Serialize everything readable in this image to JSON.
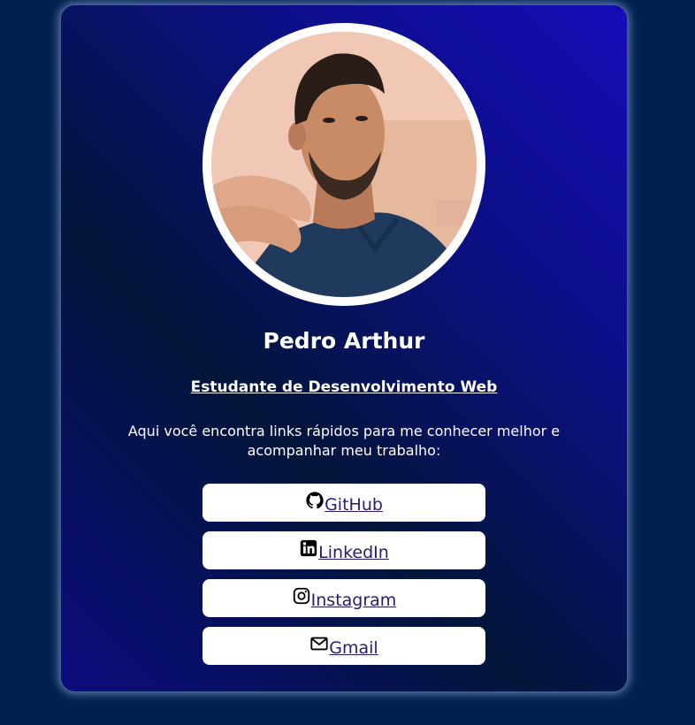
{
  "profile": {
    "name": "Pedro Arthur",
    "role": "Estudante de Desenvolvimento Web",
    "intro": "Aqui você encontra links rápidos para me conhecer melhor e acompanhar meu trabalho:",
    "avatar_icon": "profile-photo"
  },
  "links": [
    {
      "label": "GitHub",
      "icon": "github-icon"
    },
    {
      "label": "LinkedIn",
      "icon": "linkedin-icon"
    },
    {
      "label": "Instagram",
      "icon": "instagram-icon"
    },
    {
      "label": "Gmail",
      "icon": "mail-icon"
    }
  ],
  "colors": {
    "page_background": "#00214f",
    "card_gradient_start": "#150cb8",
    "card_gradient_dark": "#021539",
    "button_background": "#ffffff",
    "link_text": "#2a1a72"
  }
}
